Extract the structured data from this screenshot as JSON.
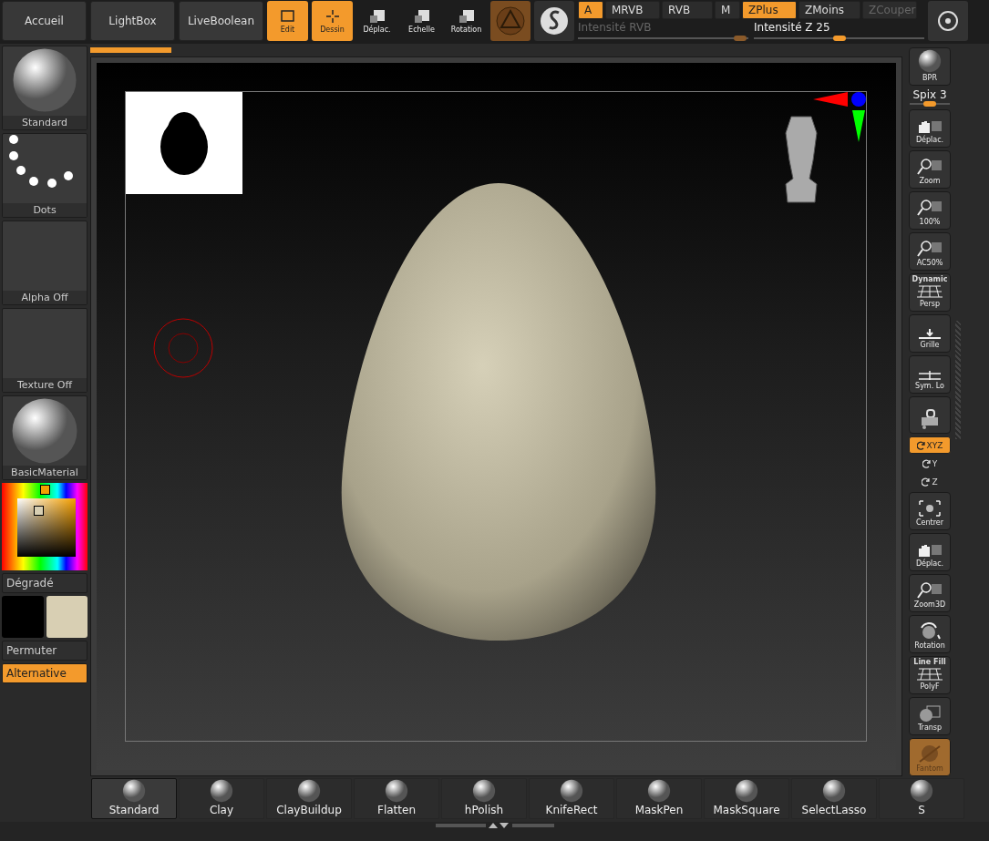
{
  "top_bar": {
    "nav_buttons": [
      {
        "label": "Accueil"
      },
      {
        "label": "LightBox"
      },
      {
        "label": "LiveBoolean"
      }
    ],
    "tools": [
      {
        "label": "Edit",
        "kind": "edit",
        "selected": true
      },
      {
        "label": "Dessin",
        "kind": "draw",
        "selected": true
      },
      {
        "label": "Déplac.",
        "kind": "move",
        "selected": false
      },
      {
        "label": "Echelle",
        "kind": "scale",
        "selected": false
      },
      {
        "label": "Rotation",
        "kind": "rotate",
        "selected": false
      }
    ],
    "modes": [
      {
        "label": "A",
        "selected": true,
        "disabled": false
      },
      {
        "label": "MRVB",
        "selected": false,
        "disabled": false
      },
      {
        "label": "RVB",
        "selected": false,
        "disabled": false
      },
      {
        "label": "M",
        "selected": false,
        "disabled": false
      },
      {
        "label": "ZPlus",
        "selected": true,
        "disabled": false
      },
      {
        "label": "ZMoins",
        "selected": false,
        "disabled": false
      },
      {
        "label": "ZCouper",
        "selected": false,
        "disabled": true
      }
    ],
    "sliders": [
      {
        "label": "Intensité RVB",
        "disabled": true,
        "level": 0.95
      },
      {
        "label": "Intensité Z",
        "value": "25",
        "disabled": false,
        "level": 0.5
      }
    ]
  },
  "left_panel": {
    "tiles": [
      {
        "label": "Standard",
        "kind": "brush"
      },
      {
        "label": "Dots",
        "kind": "stroke"
      },
      {
        "label": "Alpha Off",
        "kind": "empty"
      },
      {
        "label": "Texture Off",
        "kind": "empty"
      },
      {
        "label": "BasicMaterial",
        "kind": "material"
      }
    ],
    "gradient_label": "Dégradé",
    "swatches": [
      {
        "color": "#000000"
      },
      {
        "color": "#d8cfb3"
      }
    ],
    "buttons": [
      {
        "label": "Permuter",
        "selected": false
      },
      {
        "label": "Alternative",
        "selected": true
      }
    ]
  },
  "canvas": {
    "progress": {
      "level": 0.1
    }
  },
  "right_panel": {
    "items": [
      {
        "kind": "bpr",
        "label": "BPR"
      },
      {
        "kind": "slider",
        "label": "Spix 3",
        "level": 0.5
      },
      {
        "kind": "move",
        "label": "Déplac."
      },
      {
        "kind": "zoom",
        "label": "Zoom"
      },
      {
        "kind": "zoom",
        "label": "100%"
      },
      {
        "kind": "zoom",
        "label": "AC50%"
      },
      {
        "kind": "persp",
        "label": "Persp",
        "caption": "Dynamic"
      },
      {
        "kind": "floor",
        "label": "Grille"
      },
      {
        "kind": "sym",
        "label": "Sym. Lo"
      },
      {
        "kind": "camera"
      },
      {
        "kind": "axis",
        "label": "XYZ",
        "selected": true
      },
      {
        "kind": "axis",
        "label": "Y",
        "selected": false
      },
      {
        "kind": "axis",
        "label": "Z",
        "selected": false
      },
      {
        "kind": "center",
        "label": "Centrer"
      },
      {
        "kind": "move",
        "label": "Déplac."
      },
      {
        "kind": "zoom",
        "label": "Zoom3D"
      },
      {
        "kind": "rotate",
        "label": "Rotation"
      },
      {
        "kind": "persp",
        "label": "PolyF",
        "caption": "Line Fill"
      },
      {
        "kind": "transp",
        "label": "Transp"
      },
      {
        "kind": "ghost",
        "label": "Fantom",
        "selected": true
      }
    ]
  },
  "shelf": {
    "brushes": [
      {
        "label": "Standard",
        "selected": true
      },
      {
        "label": "Clay",
        "selected": false
      },
      {
        "label": "ClayBuildup",
        "selected": false
      },
      {
        "label": "Flatten",
        "selected": false
      },
      {
        "label": "hPolish",
        "selected": false
      },
      {
        "label": "KnifeRect",
        "selected": false
      },
      {
        "label": "MaskPen",
        "selected": false
      },
      {
        "label": "MaskSquare",
        "selected": false
      },
      {
        "label": "SelectLasso",
        "selected": false
      },
      {
        "label": "S",
        "selected": false
      }
    ]
  }
}
